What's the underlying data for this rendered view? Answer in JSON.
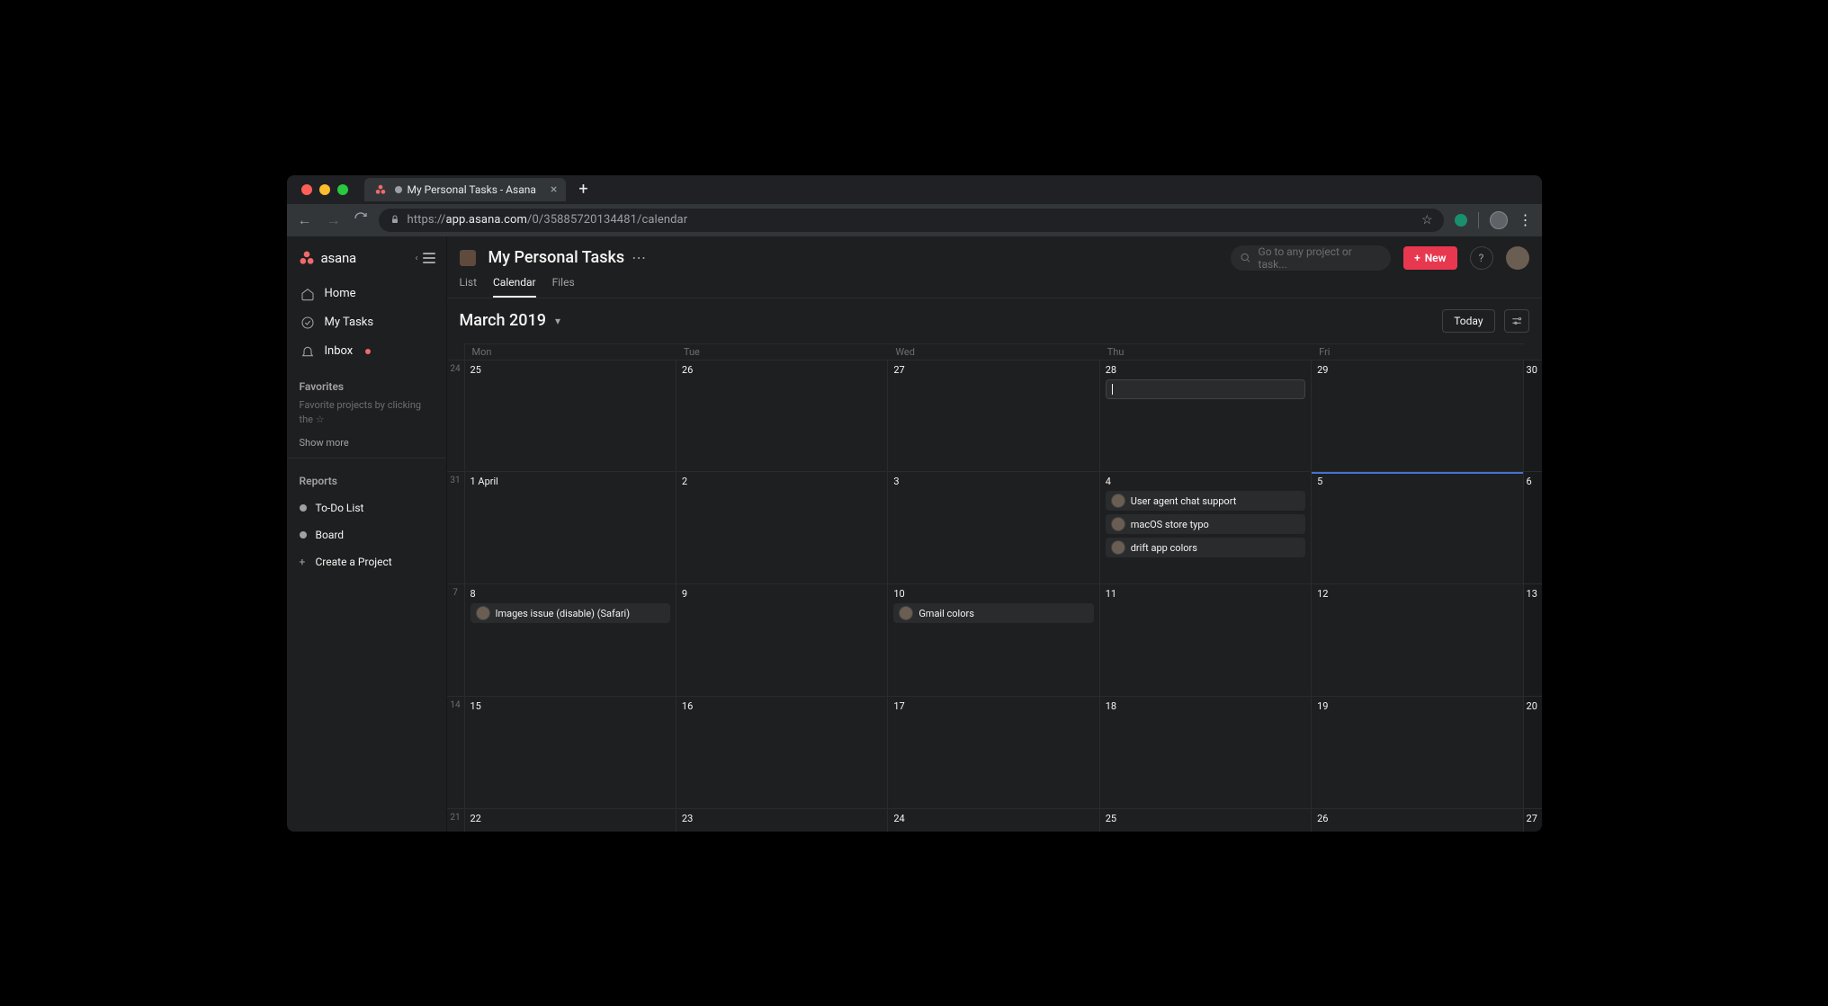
{
  "browser": {
    "tab_title": "My Personal Tasks - Asana",
    "url_prefix": "https://",
    "url_domain": "app.asana.com",
    "url_path": "/0/35885720134481/calendar"
  },
  "brand": "asana",
  "nav": {
    "home": "Home",
    "my_tasks": "My Tasks",
    "inbox": "Inbox"
  },
  "favorites": {
    "title": "Favorites",
    "hint": "Favorite projects by clicking the ☆",
    "show_more": "Show more"
  },
  "reports": {
    "title": "Reports",
    "items": [
      "To-Do List",
      "Board"
    ],
    "create": "Create a Project"
  },
  "page_title": "My Personal Tasks",
  "search_placeholder": "Go to any project or task...",
  "new_button": "New",
  "help_label": "?",
  "tabs": [
    "List",
    "Calendar",
    "Files"
  ],
  "active_tab": "Calendar",
  "month_label": "March 2019",
  "today_label": "Today",
  "weekdays": [
    "Mon",
    "Tue",
    "Wed",
    "Thu",
    "Fri"
  ],
  "weeks": [
    {
      "gutter": "24",
      "days": [
        {
          "num": "25"
        },
        {
          "num": "26"
        },
        {
          "num": "27"
        },
        {
          "num": "28",
          "new_task_input": true
        },
        {
          "num": "29"
        },
        {
          "num": "30",
          "weekend": true
        }
      ]
    },
    {
      "gutter": "31",
      "today_col": 4,
      "days": [
        {
          "num": "1 April"
        },
        {
          "num": "2"
        },
        {
          "num": "3"
        },
        {
          "num": "4",
          "tasks": [
            "User agent chat support",
            "macOS store typo",
            "drift app colors"
          ]
        },
        {
          "num": "5"
        },
        {
          "num": "6",
          "weekend": true
        }
      ]
    },
    {
      "gutter": "7",
      "days": [
        {
          "num": "8",
          "tasks": [
            "Images issue (disable) (Safari)"
          ]
        },
        {
          "num": "9"
        },
        {
          "num": "10",
          "tasks": [
            "Gmail colors"
          ]
        },
        {
          "num": "11"
        },
        {
          "num": "12"
        },
        {
          "num": "13",
          "weekend": true
        }
      ]
    },
    {
      "gutter": "14",
      "days": [
        {
          "num": "15"
        },
        {
          "num": "16"
        },
        {
          "num": "17"
        },
        {
          "num": "18"
        },
        {
          "num": "19"
        },
        {
          "num": "20",
          "weekend": true
        }
      ]
    },
    {
      "gutter": "21",
      "short": true,
      "days": [
        {
          "num": "22"
        },
        {
          "num": "23"
        },
        {
          "num": "24"
        },
        {
          "num": "25"
        },
        {
          "num": "26"
        },
        {
          "num": "27",
          "weekend": true
        }
      ]
    }
  ],
  "colors": {
    "traffic_red": "#ff5f57",
    "traffic_yellow": "#febc2e",
    "traffic_green": "#28c840"
  }
}
